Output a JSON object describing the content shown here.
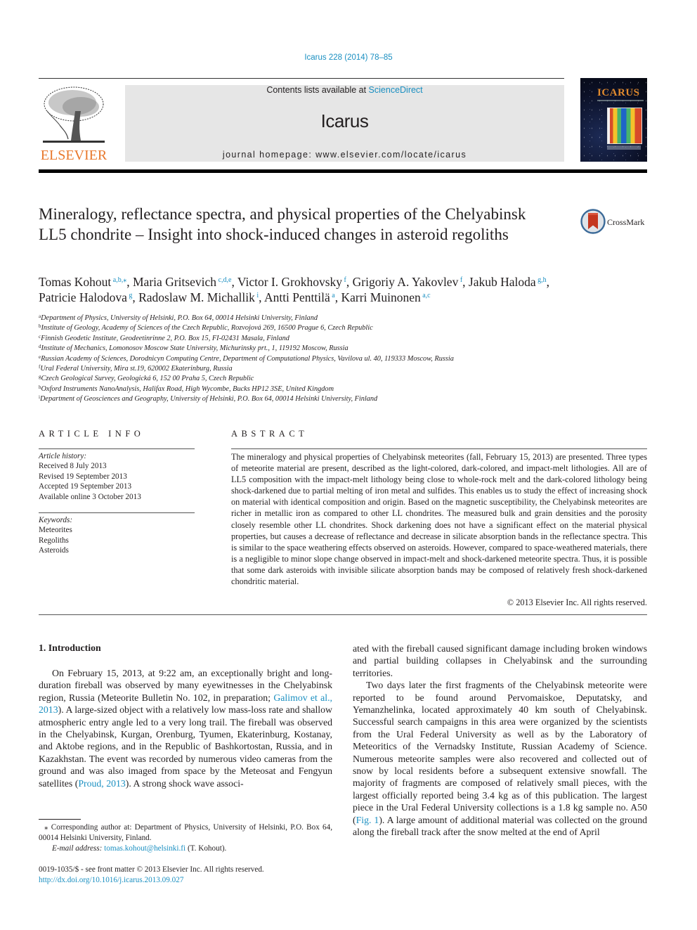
{
  "header": {
    "citation": "Icarus 228 (2014) 78–85",
    "contents_prefix": "Contents lists available at ",
    "contents_link": "ScienceDirect",
    "journal_name": "Icarus",
    "homepage": "journal homepage: www.elsevier.com/locate/icarus",
    "publisher_logo_text": "ELSEVIER",
    "cover_title": "ICARUS",
    "crossmark_label": "CrossMark"
  },
  "colors": {
    "link": "#1a8fc1",
    "elsevier_orange": "#e8782c",
    "masthead_gray": "#e6e6e6"
  },
  "article": {
    "title": "Mineralogy, reflectance spectra, and physical properties of the Chelyabinsk LL5 chondrite – Insight into shock-induced changes in asteroid regoliths",
    "authors": [
      {
        "name": "Tomas Kohout",
        "aff": "a,b,",
        "corresponding": "⁎",
        "sep": ", "
      },
      {
        "name": "Maria Gritsevich",
        "aff": "c,d,e",
        "corresponding": "",
        "sep": ", "
      },
      {
        "name": "Victor I. Grokhovsky",
        "aff": "f",
        "corresponding": "",
        "sep": ", "
      },
      {
        "name": "Grigoriy A. Yakovlev",
        "aff": "f",
        "corresponding": "",
        "sep": ", "
      },
      {
        "name": "Jakub Haloda",
        "aff": "g,h",
        "corresponding": "",
        "sep": ","
      },
      {
        "name": "Patricie Halodova",
        "aff": "g",
        "corresponding": "",
        "sep": ", "
      },
      {
        "name": "Radoslaw M. Michallik",
        "aff": "i",
        "corresponding": "",
        "sep": ", "
      },
      {
        "name": "Antti Penttilä",
        "aff": "a",
        "corresponding": "",
        "sep": ", "
      },
      {
        "name": "Karri Muinonen",
        "aff": "a,c",
        "corresponding": "",
        "sep": ""
      }
    ],
    "affiliations": [
      {
        "key": "a",
        "text": "Department of Physics, University of Helsinki, P.O. Box 64, 00014 Helsinki University, Finland"
      },
      {
        "key": "b",
        "text": "Institute of Geology, Academy of Sciences of the Czech Republic, Rozvojová 269, 16500 Prague 6, Czech Republic"
      },
      {
        "key": "c",
        "text": "Finnish Geodetic Institute, Geodeetinrinne 2, P.O. Box 15, FI-02431 Masala, Finland"
      },
      {
        "key": "d",
        "text": "Institute of Mechanics, Lomonosov Moscow State University, Michurinsky prt., 1, 119192 Moscow, Russia"
      },
      {
        "key": "e",
        "text": "Russian Academy of Sciences, Dorodnicyn Computing Centre, Department of Computational Physics, Vavilova ul. 40, 119333 Moscow, Russia"
      },
      {
        "key": "f",
        "text": "Ural Federal University, Mira st.19, 620002 Ekaterinburg, Russia"
      },
      {
        "key": "g",
        "text": "Czech Geological Survey, Geologická 6, 152 00 Praha 5, Czech Republic"
      },
      {
        "key": "h",
        "text": "Oxford Instruments NanoAnalysis, Halifax Road, High Wycombe, Bucks HP12 3SE, United Kingdom"
      },
      {
        "key": "i",
        "text": "Department of Geosciences and Geography, University of Helsinki, P.O. Box 64, 00014 Helsinki University, Finland"
      }
    ]
  },
  "article_info": {
    "heading": "ARTICLE INFO",
    "history_label": "Article history:",
    "history": [
      "Received 8 July 2013",
      "Revised 19 September 2013",
      "Accepted 19 September 2013",
      "Available online 3 October 2013"
    ],
    "keywords_label": "Keywords:",
    "keywords": [
      "Meteorites",
      "Regoliths",
      "Asteroids"
    ]
  },
  "abstract": {
    "heading": "ABSTRACT",
    "text": "The mineralogy and physical properties of Chelyabinsk meteorites (fall, February 15, 2013) are presented. Three types of meteorite material are present, described as the light-colored, dark-colored, and impact-melt lithologies. All are of LL5 composition with the impact-melt lithology being close to whole-rock melt and the dark-colored lithology being shock-darkened due to partial melting of iron metal and sulfides. This enables us to study the effect of increasing shock on material with identical composition and origin. Based on the magnetic susceptibility, the Chelyabinsk meteorites are richer in metallic iron as compared to other LL chondrites. The measured bulk and grain densities and the porosity closely resemble other LL chondrites. Shock darkening does not have a significant effect on the material physical properties, but causes a decrease of reflectance and decrease in silicate absorption bands in the reflectance spectra. This is similar to the space weathering effects observed on asteroids. However, compared to space-weathered materials, there is a negligible to minor slope change observed in impact-melt and shock-darkened meteorite spectra. Thus, it is possible that some dark asteroids with invisible silicate absorption bands may be composed of relatively fresh shock-darkened chondritic material.",
    "copyright": "© 2013 Elsevier Inc. All rights reserved."
  },
  "body": {
    "intro_heading": "1. Introduction",
    "left_p1_a": "On February 15, 2013, at 9:22 am, an exceptionally bright and long-duration fireball was observed by many eyewitnesses in the Chelyabinsk region, Russia (Meteorite Bulletin No. 102, in preparation; ",
    "left_p1_link1": "Galimov et al., 2013",
    "left_p1_b": "). A large-sized object with a relatively low mass-loss rate and shallow atmospheric entry angle led to a very long trail. The fireball was observed in the Chelyabinsk, Kurgan, Orenburg, Tyumen, Ekaterinburg, Kostanay, and Aktobe regions, and in the Republic of Bashkortostan, Russia, and in Kazakhstan. The event was recorded by numerous video cameras from the ground and was also imaged from space by the Meteosat and Fengyun satellites (",
    "left_p1_link2": "Proud, 2013",
    "left_p1_c": "). A strong shock wave associ-",
    "right_p1": "ated with the fireball caused significant damage including broken windows and partial building collapses in Chelyabinsk and the surrounding territories.",
    "right_p2_a": "Two days later the first fragments of the Chelyabinsk meteorite were reported to be found around Pervomaiskoe, Deputatsky, and Yemanzhelinka, located approximately 40 km south of Chelyabinsk. Successful search campaigns in this area were organized by the scientists from the Ural Federal University as well as by the Laboratory of Meteoritics of the Vernadsky Institute, Russian Academy of Science. Numerous meteorite samples were also recovered and collected out of snow by local residents before a subsequent extensive snowfall. The majority of fragments are composed of relatively small pieces, with the largest officially reported being 3.4 kg as of this publication. The largest piece in the Ural Federal University collections is a 1.8 kg sample no. A50 (",
    "right_p2_link": "Fig. 1",
    "right_p2_b": "). A large amount of additional material was collected on the ground along the fireball track after the snow melted at the end of April"
  },
  "footnotes": {
    "corresponding": "⁎ Corresponding author at: Department of Physics, University of Helsinki, P.O. Box 64, 00014 Helsinki University, Finland.",
    "email_label": "E-mail address: ",
    "email": "tomas.kohout@helsinki.fi",
    "email_suffix": " (T. Kohout).",
    "front_matter": "0019-1035/$ - see front matter © 2013 Elsevier Inc. All rights reserved.",
    "doi": "http://dx.doi.org/10.1016/j.icarus.2013.09.027"
  }
}
